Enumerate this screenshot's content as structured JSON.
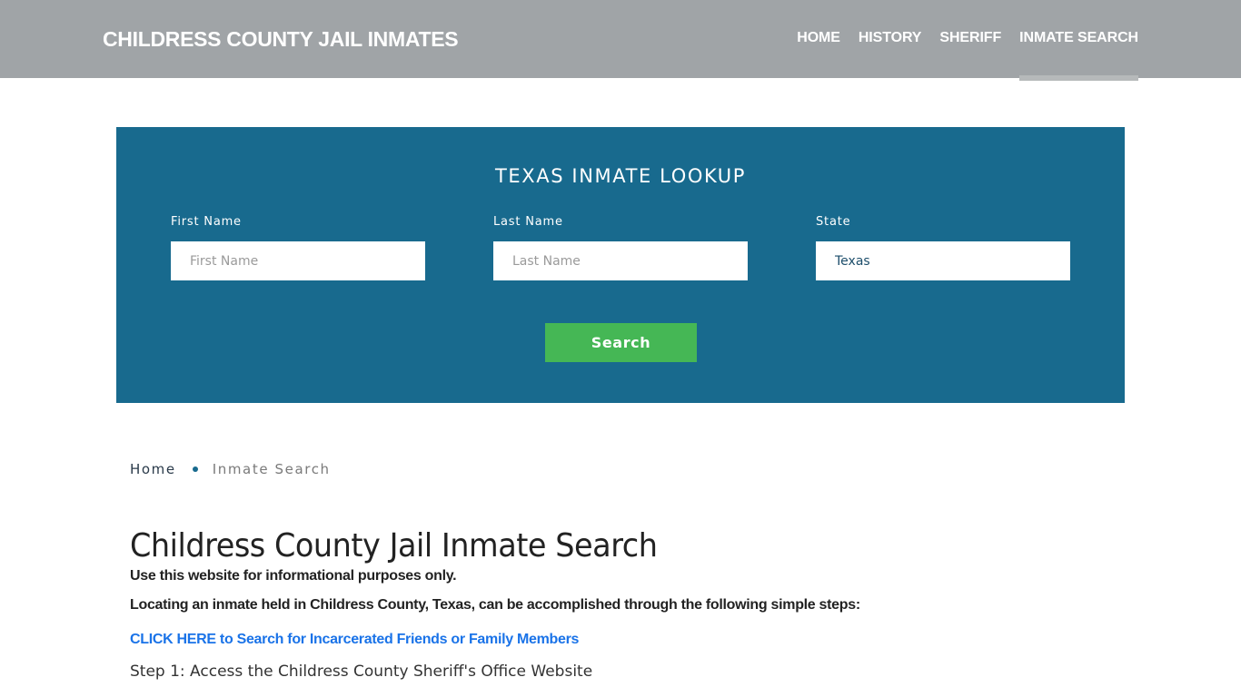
{
  "header": {
    "brand": "CHILDRESS COUNTY JAIL INMATES",
    "nav": [
      {
        "label": "HOME",
        "active": false
      },
      {
        "label": "HISTORY",
        "active": false
      },
      {
        "label": "SHERIFF",
        "active": false
      },
      {
        "label": "INMATE SEARCH",
        "active": true
      }
    ]
  },
  "lookup": {
    "title": "TEXAS INMATE LOOKUP",
    "first_name": {
      "label": "First Name",
      "placeholder": "First Name",
      "value": ""
    },
    "last_name": {
      "label": "Last Name",
      "placeholder": "Last Name",
      "value": ""
    },
    "state": {
      "label": "State",
      "value": "Texas"
    },
    "search_label": "Search"
  },
  "breadcrumb": {
    "home": "Home",
    "current": "Inmate Search"
  },
  "content": {
    "title": "Childress County Jail Inmate Search",
    "disclaimer": "Use this website for informational purposes only.",
    "intro": "Locating an inmate held in Childress County, Texas, can be accomplished through the following simple steps:",
    "cta": "CLICK HERE to Search for Incarcerated Friends or Family Members",
    "step1": "Step 1: Access the Childress County Sheriff's Office Website"
  },
  "colors": {
    "header_bg": "#a0a4a7",
    "panel_bg": "#186a8e",
    "button_bg": "#45b755",
    "link": "#1a73e8"
  }
}
